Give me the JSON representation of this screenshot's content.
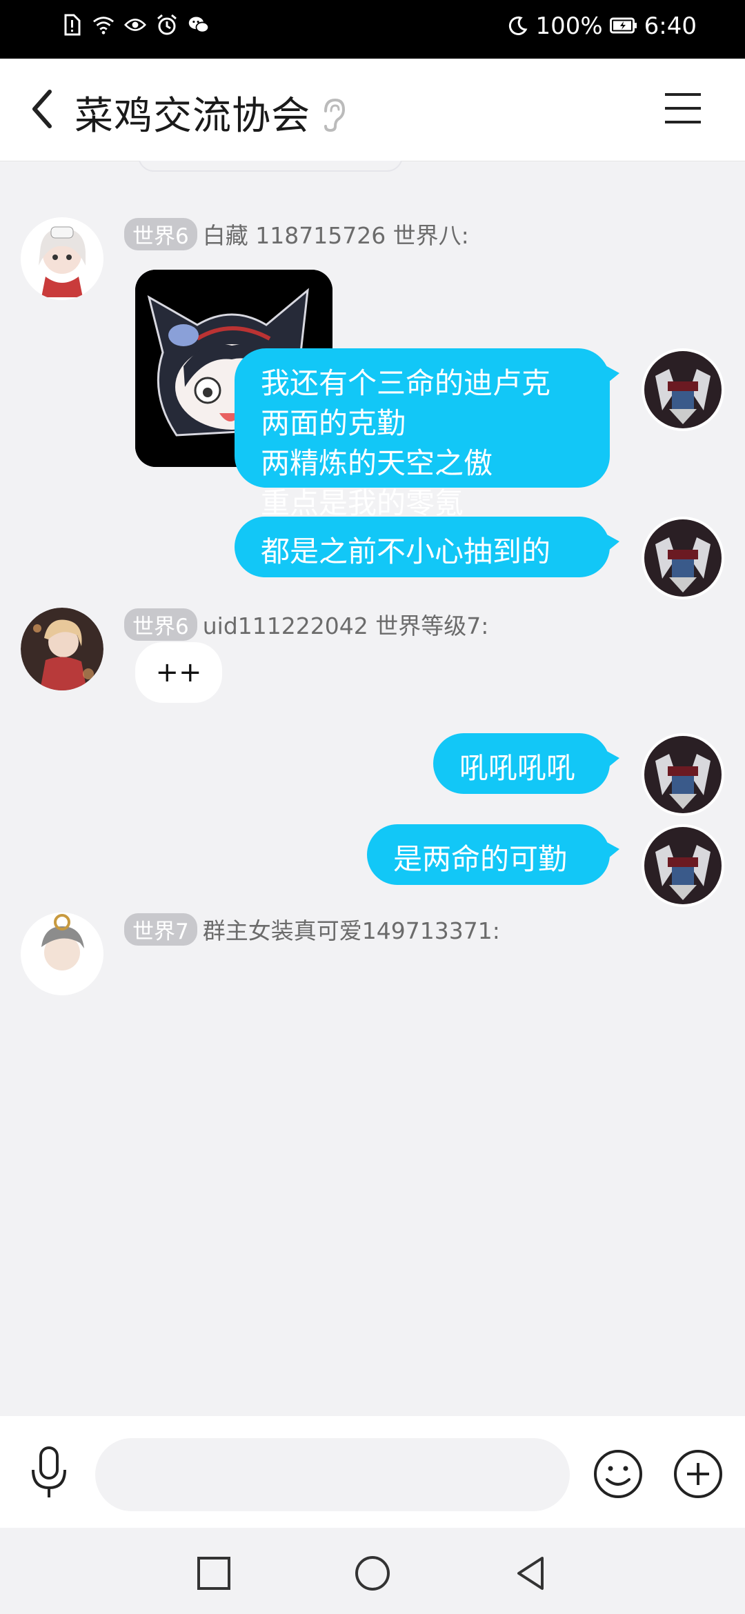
{
  "status_bar": {
    "battery": "100%",
    "time": "6:40",
    "icons": [
      "sim-alert-icon",
      "wifi-icon",
      "eye-icon",
      "alarm-icon",
      "wechat-icon",
      "moon-icon",
      "battery-icon"
    ]
  },
  "header": {
    "back_icon": "chevron-left-icon",
    "title": "菜鸡交流协会",
    "ear_icon": "ear-icon",
    "menu_icon": "hamburger-menu-icon"
  },
  "messages": [
    {
      "direction": "in",
      "level": "世界6",
      "sender": "白藏 118715726 世界八:",
      "content_type": "sticker",
      "sticker": "anime-girl-sticker"
    },
    {
      "direction": "out",
      "lines": [
        "我还有个三命的迪卢克",
        "两面的克勤",
        "两精炼的天空之傲",
        "重点是我的零氪"
      ]
    },
    {
      "direction": "out",
      "lines": [
        "都是之前不小心抽到的"
      ]
    },
    {
      "direction": "in",
      "level": "世界6",
      "sender": "uid111222042 世界等级7:",
      "text": "++"
    },
    {
      "direction": "out",
      "lines": [
        "吼吼吼吼"
      ]
    },
    {
      "direction": "out",
      "lines": [
        "是两命的可勤"
      ]
    },
    {
      "direction": "in",
      "level": "世界7",
      "sender": "群主女装真可爱149713371:"
    }
  ],
  "input_bar": {
    "placeholder": "",
    "mic_icon": "microphone-icon",
    "emoji_icon": "smiley-icon",
    "plus_icon": "plus-circle-icon"
  },
  "nav_bar": {
    "icons": [
      "square-recents-icon",
      "circle-home-icon",
      "triangle-back-icon"
    ]
  },
  "colors": {
    "outgoing_bubble": "#12c7f7",
    "incoming_bubble": "#ffffff",
    "background": "#f2f2f4",
    "badge": "#c8c8cc"
  }
}
